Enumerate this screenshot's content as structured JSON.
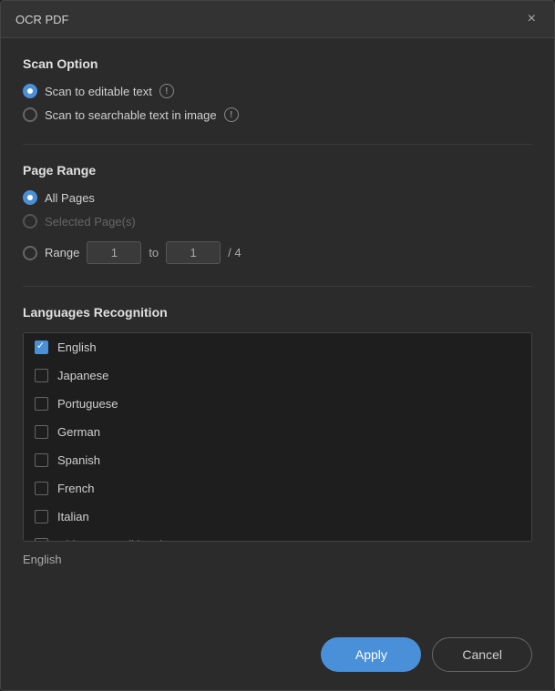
{
  "dialog": {
    "title": "OCR PDF",
    "close_label": "×"
  },
  "scan_option": {
    "title": "Scan Option",
    "options": [
      {
        "id": "editable",
        "label": "Scan to editable text",
        "checked": true,
        "has_info": true
      },
      {
        "id": "searchable",
        "label": "Scan to searchable text in image",
        "checked": false,
        "has_info": true
      }
    ]
  },
  "page_range": {
    "title": "Page Range",
    "options": [
      {
        "id": "all",
        "label": "All Pages",
        "checked": true
      },
      {
        "id": "selected",
        "label": "Selected Page(s)",
        "checked": false,
        "disabled": true
      },
      {
        "id": "range",
        "label": "Range",
        "checked": false
      }
    ],
    "range_from": "1",
    "range_to": "1",
    "total": "4",
    "to_label": "to",
    "slash_label": "/ 4"
  },
  "languages": {
    "title": "Languages Recognition",
    "items": [
      {
        "name": "English",
        "checked": true
      },
      {
        "name": "Japanese",
        "checked": false
      },
      {
        "name": "Portuguese",
        "checked": false
      },
      {
        "name": "German",
        "checked": false
      },
      {
        "name": "Spanish",
        "checked": false
      },
      {
        "name": "French",
        "checked": false
      },
      {
        "name": "Italian",
        "checked": false
      },
      {
        "name": "Chinese_Traditional",
        "checked": false
      }
    ],
    "selected_display": "English"
  },
  "footer": {
    "apply_label": "Apply",
    "cancel_label": "Cancel"
  }
}
